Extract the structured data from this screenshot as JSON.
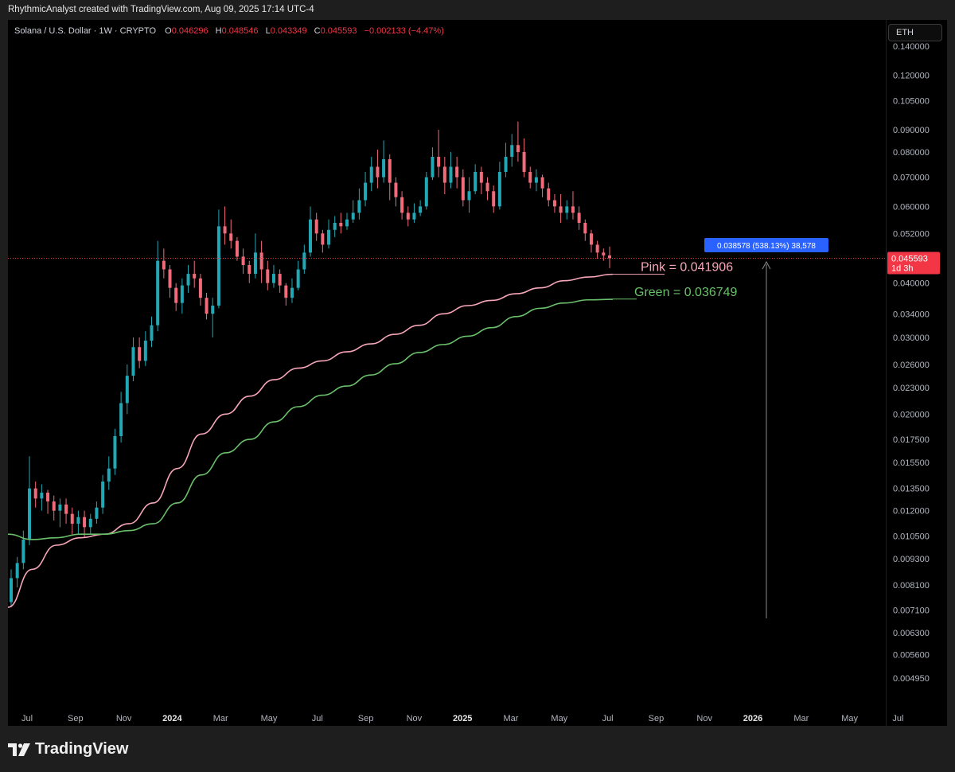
{
  "header": {
    "text": "RhythmicAnalyst created with TradingView.com, Aug 09, 2025 17:14 UTC-4"
  },
  "legend": {
    "symbol": "Solana / U.S. Dollar · 1W · CRYPTO",
    "o_key": "O",
    "o": "0.046296",
    "h_key": "H",
    "h": "0.048546",
    "l_key": "L",
    "l": "0.043349",
    "c_key": "C",
    "c": "0.045593",
    "change": "−0.002133 (−4.47%)"
  },
  "toolbar": {
    "symbol_button": "ETH"
  },
  "footer": {
    "brand": "TradingView"
  },
  "colors": {
    "up": "#22a7b5",
    "down": "#f26b7a",
    "pink_ma": "#f7a6b8",
    "green_ma": "#6ac06a",
    "price_tag": "#f23645",
    "measure_tag": "#2962ff"
  },
  "chart_data": {
    "type": "candlestick",
    "title": "Solana / U.S. Dollar · 1W · CRYPTO",
    "scale": "log",
    "y_ticks": [
      "0.140000",
      "0.120000",
      "0.105000",
      "0.090000",
      "0.080000",
      "0.070000",
      "0.060000",
      "0.052000",
      "0.040000",
      "0.034000",
      "0.030000",
      "0.026000",
      "0.023000",
      "0.020000",
      "0.017500",
      "0.015500",
      "0.013500",
      "0.012000",
      "0.010500",
      "0.009300",
      "0.008100",
      "0.007100",
      "0.006300",
      "0.005600",
      "0.004950"
    ],
    "x_ticks": [
      "Jul",
      "Sep",
      "Nov",
      "2024",
      "Mar",
      "May",
      "Jul",
      "Sep",
      "Nov",
      "2025",
      "Mar",
      "May",
      "Jul",
      "Sep",
      "Nov",
      "2026",
      "Mar",
      "May",
      "Jul"
    ],
    "x_ticks_bold": [
      "2024",
      "2025",
      "2026"
    ],
    "last_price": {
      "value": "0.045593",
      "countdown": "1d 3h"
    },
    "measure_label": "0.038578 (538.13%) 38,578",
    "series": [
      {
        "name": "Pink",
        "label_text": "Pink =  0.041906",
        "color": "#f7a6b8",
        "last": 0.041906,
        "anchors": [
          [
            0,
            0.0072
          ],
          [
            4,
            0.0088
          ],
          [
            8,
            0.01
          ],
          [
            12,
            0.0104
          ],
          [
            16,
            0.0106
          ],
          [
            20,
            0.0112
          ],
          [
            24,
            0.0125
          ],
          [
            28,
            0.015
          ],
          [
            32,
            0.018
          ],
          [
            36,
            0.02
          ],
          [
            40,
            0.022
          ],
          [
            44,
            0.024
          ],
          [
            48,
            0.0255
          ],
          [
            52,
            0.0265
          ],
          [
            56,
            0.0278
          ],
          [
            60,
            0.029
          ],
          [
            64,
            0.0305
          ],
          [
            68,
            0.032
          ],
          [
            72,
            0.034
          ],
          [
            76,
            0.0355
          ],
          [
            80,
            0.0365
          ],
          [
            84,
            0.0378
          ],
          [
            88,
            0.039
          ],
          [
            92,
            0.0405
          ],
          [
            96,
            0.0413
          ],
          [
            100,
            0.0419
          ]
        ]
      },
      {
        "name": "Green",
        "label_text": "Green =  0.036749",
        "color": "#6ac06a",
        "last": 0.036749,
        "anchors": [
          [
            0,
            0.0106
          ],
          [
            4,
            0.0103
          ],
          [
            8,
            0.0104
          ],
          [
            12,
            0.0106
          ],
          [
            16,
            0.0106
          ],
          [
            20,
            0.0108
          ],
          [
            24,
            0.0112
          ],
          [
            28,
            0.0125
          ],
          [
            32,
            0.0145
          ],
          [
            36,
            0.0163
          ],
          [
            40,
            0.0175
          ],
          [
            44,
            0.0192
          ],
          [
            48,
            0.0208
          ],
          [
            52,
            0.0221
          ],
          [
            56,
            0.0232
          ],
          [
            60,
            0.0246
          ],
          [
            64,
            0.0261
          ],
          [
            68,
            0.0277
          ],
          [
            72,
            0.0289
          ],
          [
            76,
            0.0302
          ],
          [
            80,
            0.0316
          ],
          [
            84,
            0.0335
          ],
          [
            88,
            0.035
          ],
          [
            92,
            0.036
          ],
          [
            96,
            0.0366
          ],
          [
            100,
            0.0367
          ]
        ]
      }
    ],
    "candles": [
      [
        0.0074,
        0.0084,
        0.0072,
        0.0088
      ],
      [
        0.0084,
        0.0091,
        0.008,
        0.0094
      ],
      [
        0.0091,
        0.0103,
        0.0088,
        0.0108
      ],
      [
        0.0103,
        0.0135,
        0.01,
        0.016
      ],
      [
        0.0135,
        0.0128,
        0.0122,
        0.014
      ],
      [
        0.0128,
        0.0132,
        0.012,
        0.0138
      ],
      [
        0.0132,
        0.0126,
        0.0118,
        0.0134
      ],
      [
        0.0126,
        0.012,
        0.0114,
        0.013
      ],
      [
        0.012,
        0.0124,
        0.011,
        0.0128
      ],
      [
        0.0124,
        0.0118,
        0.0112,
        0.0128
      ],
      [
        0.0118,
        0.0112,
        0.0106,
        0.0122
      ],
      [
        0.0112,
        0.0116,
        0.0106,
        0.012
      ],
      [
        0.0116,
        0.011,
        0.0104,
        0.012
      ],
      [
        0.011,
        0.0115,
        0.0106,
        0.0118
      ],
      [
        0.0115,
        0.0122,
        0.0112,
        0.0126
      ],
      [
        0.0122,
        0.014,
        0.0118,
        0.0145
      ],
      [
        0.014,
        0.015,
        0.0134,
        0.016
      ],
      [
        0.015,
        0.0178,
        0.0145,
        0.0185
      ],
      [
        0.0178,
        0.0212,
        0.0172,
        0.0225
      ],
      [
        0.0212,
        0.0245,
        0.02,
        0.026
      ],
      [
        0.0245,
        0.0285,
        0.0238,
        0.03
      ],
      [
        0.0285,
        0.0265,
        0.0255,
        0.03
      ],
      [
        0.0265,
        0.0295,
        0.0258,
        0.031
      ],
      [
        0.0295,
        0.032,
        0.0285,
        0.0335
      ],
      [
        0.032,
        0.045,
        0.031,
        0.05
      ],
      [
        0.045,
        0.043,
        0.041,
        0.048
      ],
      [
        0.043,
        0.039,
        0.037,
        0.044
      ],
      [
        0.039,
        0.036,
        0.0345,
        0.04
      ],
      [
        0.036,
        0.0395,
        0.034,
        0.041
      ],
      [
        0.0395,
        0.042,
        0.038,
        0.044
      ],
      [
        0.042,
        0.041,
        0.039,
        0.045
      ],
      [
        0.041,
        0.037,
        0.0355,
        0.042
      ],
      [
        0.037,
        0.034,
        0.033,
        0.038
      ],
      [
        0.034,
        0.0355,
        0.03,
        0.037
      ],
      [
        0.0355,
        0.054,
        0.035,
        0.059
      ],
      [
        0.054,
        0.052,
        0.049,
        0.06
      ],
      [
        0.052,
        0.05,
        0.048,
        0.056
      ],
      [
        0.05,
        0.046,
        0.045,
        0.051
      ],
      [
        0.046,
        0.044,
        0.042,
        0.048
      ],
      [
        0.044,
        0.042,
        0.04,
        0.045
      ],
      [
        0.042,
        0.047,
        0.041,
        0.052
      ],
      [
        0.047,
        0.043,
        0.04,
        0.05
      ],
      [
        0.043,
        0.04,
        0.0385,
        0.045
      ],
      [
        0.04,
        0.042,
        0.039,
        0.044
      ],
      [
        0.042,
        0.0395,
        0.038,
        0.043
      ],
      [
        0.0395,
        0.037,
        0.0355,
        0.04
      ],
      [
        0.037,
        0.039,
        0.036,
        0.041
      ],
      [
        0.039,
        0.043,
        0.0385,
        0.045
      ],
      [
        0.043,
        0.047,
        0.042,
        0.049
      ],
      [
        0.047,
        0.056,
        0.046,
        0.06
      ],
      [
        0.056,
        0.052,
        0.05,
        0.058
      ],
      [
        0.052,
        0.049,
        0.047,
        0.053
      ],
      [
        0.049,
        0.053,
        0.048,
        0.056
      ],
      [
        0.053,
        0.055,
        0.051,
        0.057
      ],
      [
        0.055,
        0.054,
        0.052,
        0.058
      ],
      [
        0.054,
        0.056,
        0.053,
        0.058
      ],
      [
        0.056,
        0.058,
        0.055,
        0.062
      ],
      [
        0.058,
        0.062,
        0.056,
        0.066
      ],
      [
        0.062,
        0.068,
        0.06,
        0.072
      ],
      [
        0.068,
        0.074,
        0.065,
        0.078
      ],
      [
        0.074,
        0.07,
        0.066,
        0.081
      ],
      [
        0.07,
        0.077,
        0.068,
        0.085
      ],
      [
        0.077,
        0.068,
        0.062,
        0.079
      ],
      [
        0.068,
        0.063,
        0.06,
        0.07
      ],
      [
        0.063,
        0.058,
        0.056,
        0.065
      ],
      [
        0.058,
        0.056,
        0.054,
        0.06
      ],
      [
        0.056,
        0.058,
        0.055,
        0.061
      ],
      [
        0.058,
        0.06,
        0.057,
        0.062
      ],
      [
        0.06,
        0.07,
        0.059,
        0.072
      ],
      [
        0.07,
        0.078,
        0.069,
        0.082
      ],
      [
        0.078,
        0.074,
        0.07,
        0.09
      ],
      [
        0.074,
        0.068,
        0.064,
        0.078
      ],
      [
        0.068,
        0.074,
        0.066,
        0.08
      ],
      [
        0.074,
        0.07,
        0.066,
        0.078
      ],
      [
        0.07,
        0.062,
        0.06,
        0.073
      ],
      [
        0.062,
        0.065,
        0.058,
        0.07
      ],
      [
        0.065,
        0.072,
        0.064,
        0.075
      ],
      [
        0.072,
        0.068,
        0.064,
        0.074
      ],
      [
        0.068,
        0.065,
        0.062,
        0.07
      ],
      [
        0.065,
        0.06,
        0.058,
        0.067
      ],
      [
        0.06,
        0.072,
        0.059,
        0.076
      ],
      [
        0.072,
        0.078,
        0.07,
        0.084
      ],
      [
        0.078,
        0.083,
        0.074,
        0.088
      ],
      [
        0.083,
        0.08,
        0.076,
        0.094
      ],
      [
        0.08,
        0.072,
        0.07,
        0.086
      ],
      [
        0.072,
        0.068,
        0.066,
        0.074
      ],
      [
        0.068,
        0.07,
        0.065,
        0.073
      ],
      [
        0.07,
        0.066,
        0.063,
        0.071
      ],
      [
        0.066,
        0.062,
        0.06,
        0.068
      ],
      [
        0.062,
        0.06,
        0.058,
        0.064
      ],
      [
        0.06,
        0.058,
        0.055,
        0.064
      ],
      [
        0.058,
        0.06,
        0.056,
        0.062
      ],
      [
        0.06,
        0.058,
        0.056,
        0.065
      ],
      [
        0.058,
        0.055,
        0.053,
        0.06
      ],
      [
        0.055,
        0.052,
        0.05,
        0.056
      ],
      [
        0.052,
        0.049,
        0.047,
        0.053
      ],
      [
        0.049,
        0.047,
        0.0455,
        0.05
      ],
      [
        0.047,
        0.0463,
        0.045,
        0.048
      ],
      [
        0.0463,
        0.0456,
        0.0433,
        0.0485
      ]
    ]
  }
}
